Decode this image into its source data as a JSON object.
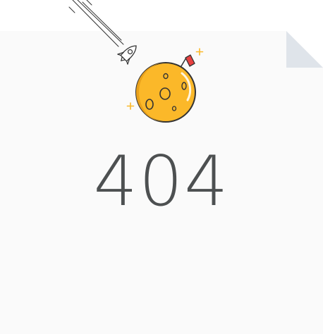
{
  "error": {
    "code": "404"
  },
  "illustration": {
    "rocket": "rocket-icon",
    "moon": "moon-icon",
    "flag": "flag-icon",
    "sparkles": "sparkle-icon"
  },
  "colors": {
    "page_background": "#fafafa",
    "page_fold": "#dfe4ea",
    "moon_fill": "#fbb829",
    "moon_shadow": "#f1a51d",
    "flag_red": "#e84040",
    "text": "#4d5051",
    "outline": "#333333"
  }
}
